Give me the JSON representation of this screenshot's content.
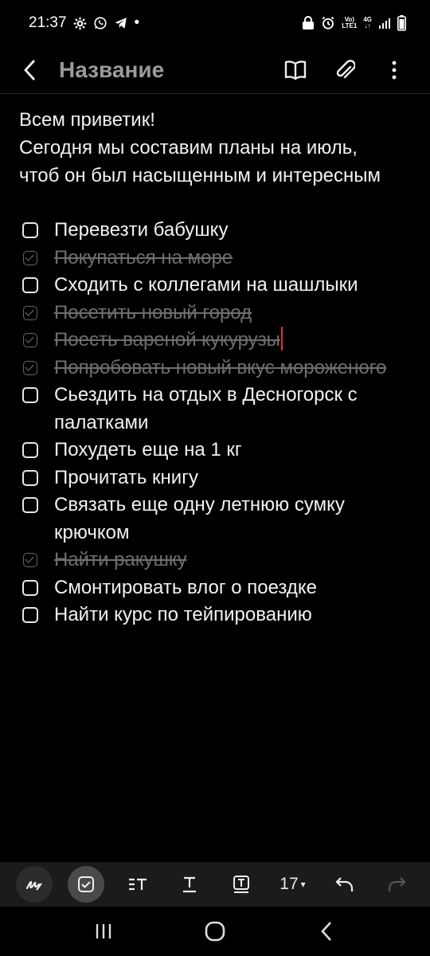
{
  "status": {
    "time": "21:37",
    "dot": "•",
    "volte_top": "Vo)",
    "volte_bottom": "LTE1",
    "network_top": "4G",
    "network_bottom": "↓↑"
  },
  "header": {
    "title": "Название"
  },
  "note": {
    "intro_lines": [
      "Всем приветик!",
      "Сегодня мы составим планы на июль,",
      "чтоб он был насыщенным и интересным"
    ],
    "tasks": [
      {
        "text": "Перевезти бабушку",
        "done": false
      },
      {
        "text": "Покупаться на море",
        "done": true
      },
      {
        "text": "Сходить с коллегами на шашлыки",
        "done": false
      },
      {
        "text": "Посетить новый город",
        "done": true
      },
      {
        "text": "Поесть вареной кукурузы",
        "done": true
      },
      {
        "text": "Попробовать новый вкус мороженого",
        "done": true
      },
      {
        "text": "Сьездить на отдых в Десногорск с палатками",
        "done": false
      },
      {
        "text": "Похудеть еще на 1 кг",
        "done": false
      },
      {
        "text": "Прочитать книгу",
        "done": false
      },
      {
        "text": "Связать еще одну летнюю сумку крючком",
        "done": false
      },
      {
        "text": "Найти ракушку",
        "done": true
      },
      {
        "text": "Смонтировать влог о поездке",
        "done": false
      },
      {
        "text": "Найти курс по тейпированию",
        "done": false
      }
    ]
  },
  "toolbar": {
    "font_size": "17",
    "caret": "▾"
  },
  "colors": {
    "background": "#000000",
    "text": "#f2f2f2",
    "muted": "#6e6e6e",
    "title": "#9a9a9a",
    "toolbar_bg": "#1b1b1b",
    "cursor": "#e03030"
  }
}
